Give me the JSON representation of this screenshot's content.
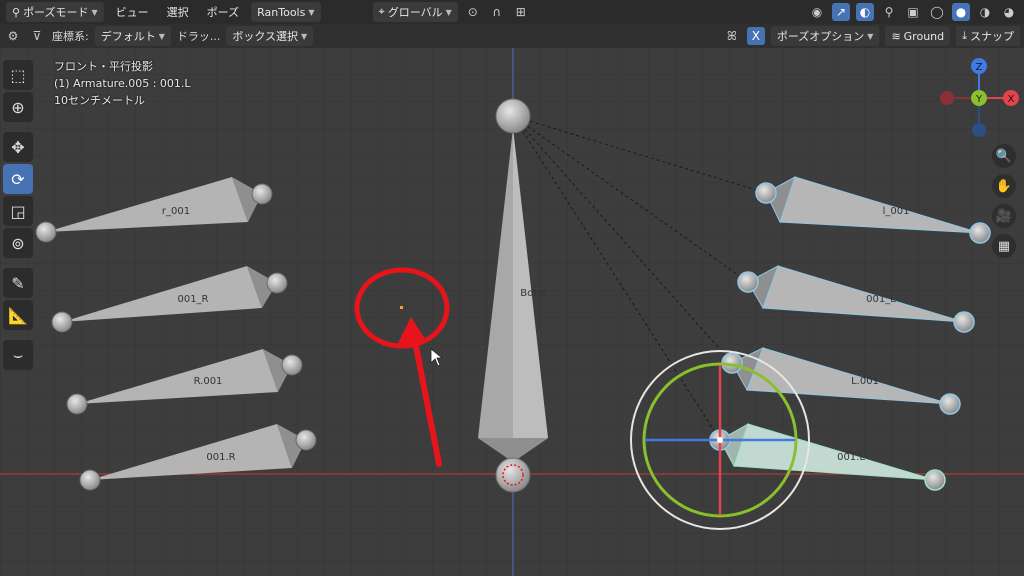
{
  "topbar": {
    "mode_label": "ポーズモード",
    "menus": [
      "ビュー",
      "選択",
      "ポーズ"
    ],
    "addon_label": "RanTools",
    "transform_orientation": "グローバル"
  },
  "subbar": {
    "coord_label": "座標系:",
    "coord_value": "デフォルト",
    "drag_label": "ドラッ...",
    "drag_value": "ボックス選択",
    "mirror_x": "X",
    "pose_options": "ポーズオプション",
    "ground_label": "Ground",
    "snap_label": "スナップ"
  },
  "viewport_info": {
    "view_name": "フロント・平行投影",
    "object_name": "(1) Armature.005 : 001.L",
    "scale": "10センチメートル"
  },
  "gizmo": {
    "z": "Z",
    "y": "Y",
    "x": "X"
  },
  "bones": {
    "center": "Bone",
    "left": [
      "r_001",
      "001_R",
      "R.001",
      "001.R"
    ],
    "right": [
      "l_001",
      "001_L",
      "L.001",
      "001.L"
    ]
  },
  "colors": {
    "accent": "#4772b3",
    "selected_bone": "#8ec6e6",
    "annotation": "#e8141c",
    "x_axis": "#b03a3a",
    "y_axis": "#4a6ab0",
    "gizmo_x": "#e0454f",
    "gizmo_y": "#8bbf2e",
    "gizmo_z": "#3f7be3"
  },
  "icons": [
    "select-box-icon",
    "cursor-icon",
    "move-icon",
    "rotate-icon",
    "scale-icon",
    "transform-icon",
    "annotate-icon",
    "measure-icon",
    "curve-icon",
    "zoom-icon",
    "hand-icon",
    "camera-icon",
    "grid-icon"
  ]
}
